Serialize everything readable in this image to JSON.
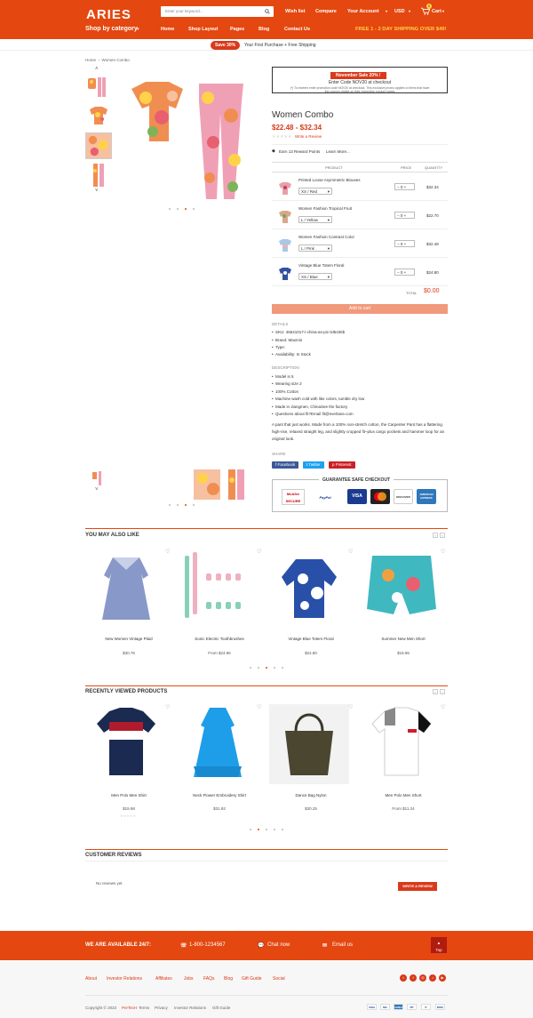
{
  "header": {
    "logo": "ARIES",
    "search_placeholder": "Enter your keyword...",
    "wishlist": "Wish list",
    "compare": "Compare",
    "account": "Your Account",
    "currency": "USD",
    "cart": "Cart",
    "cart_count": "0",
    "category": "Shop by category",
    "nav": [
      "Home",
      "Shop Layout",
      "Pages",
      "Blog",
      "Contact Us"
    ],
    "shipping": "FREE 1 - 2 DAY SHIPPING OVER $49!"
  },
  "promo": {
    "badge": "Save 30%",
    "text": "Your First Purchase + Free Shipping"
  },
  "breadcrumb": {
    "home": "Home",
    "current": "Women Combo"
  },
  "sale_box": {
    "title": "November Sale 20% !",
    "line1": "Enter Code NOV20 at checkout",
    "line2": "(*) To redeem enter promotion code NOV20 at checkout. This exclusive promo applies to items that have this coupon visible on their respective product pages"
  },
  "product": {
    "title": "Women Combo",
    "price": "$22.48   - $32.34",
    "review": "Write a Review",
    "reward": "Earn 13 Reward Points",
    "learn_more": "Learn More..."
  },
  "combo_table": {
    "headers": [
      "PRODUCT",
      "PRICE",
      "QUANTITY"
    ],
    "rows": [
      {
        "name": "Printed Loose Asymmetric Blouses",
        "option": "XS / Red",
        "qty": "0",
        "price": "$32.34"
      },
      {
        "name": "Women Fashion Tropical Fruit",
        "option": "L / Yellow",
        "qty": "0",
        "price": "$22.70"
      },
      {
        "name": "Women Fashion Contrast Color",
        "option": "L / Pink",
        "qty": "0",
        "price": "$32.48"
      },
      {
        "name": "Vintage Blue Totem Floral",
        "option": "XS / Blue",
        "qty": "0",
        "price": "$24.80"
      }
    ],
    "total_label": "TOTAL",
    "total": "$0.00"
  },
  "add_to_cart": "Add to cart",
  "details": {
    "title": "DETAILS",
    "items": [
      "SKU: 45541017-i-china-as-pic-lxl5436b",
      "Brand: Maxmin",
      "Type:",
      "Availability: In Stock"
    ]
  },
  "description": {
    "title": "DESCRIPTION",
    "items": [
      "Model is 5",
      "Wearing size 2",
      "100% Cotton",
      "Machine wash cold with like colors, tumble dry low",
      "Made in Jiangmen, ChinaSee the factory",
      "Questions about fit?Email fit@everlane.com"
    ],
    "para": "A pant that just works. Made from a 100% non-stretch cotton, the Carpenter Pant has a flattering high-rise, relaxed straight leg, and slightly cropped fit–plus cargo pockets and hammer loop for an original look."
  },
  "share": {
    "title": "SHARE",
    "facebook": "Facebook",
    "twitter": "Twitter",
    "pinterest": "Pinterest"
  },
  "guarantee": {
    "title": "GUARANTEE SAFE CHECKOUT",
    "mcafee": "McAfee SECURE",
    "paypal": "PayPal",
    "visa": "VISA",
    "discover": "DISCOVER",
    "amex": "AMERICAN EXPRESS"
  },
  "also_like": {
    "title": "YOU MAY ALSO LIKE",
    "items": [
      {
        "name": "New Women Vintage Plaid",
        "price": "$30.76"
      },
      {
        "name": "Sonic Electric Toothbrushes",
        "price": "From $24.96"
      },
      {
        "name": "Vintage Blue Totem Floral",
        "price": "$24.80"
      },
      {
        "name": "Summer New Men Short",
        "price": "$18.96"
      }
    ]
  },
  "recent": {
    "title": "RECENTLY VIEWED PRODUCTS",
    "items": [
      {
        "name": "Men Polo Men Shirt",
        "price": "$19.98"
      },
      {
        "name": "Neck Flower Embroidery Shirt",
        "price": "$31.92"
      },
      {
        "name": "Dance Bag Nylon",
        "price": "$30.25"
      },
      {
        "name": "Men Polo Men Short",
        "price": "From $11.24"
      }
    ]
  },
  "reviews": {
    "title": "CUSTOMER REVIEWS",
    "empty": "No reviews yet",
    "button": "WRITE A REVIEW"
  },
  "footer": {
    "available": "WE ARE AVAILABLE 24/7:",
    "phone": "1-800-1234567",
    "chat": "Chat now",
    "email": "Email us",
    "top": "Top",
    "links": [
      "About",
      "Investor Relations",
      "Affiliates",
      "Jobs",
      "FAQs",
      "Blog",
      "Gift Guide",
      "Social"
    ],
    "copyright": "Copyright © 2022",
    "brand": "PerTecH",
    "legal": [
      "Terms",
      "Privacy",
      "Investor Relations",
      "Gift Guide"
    ],
    "payments": [
      "VISA",
      "MC",
      "AMEX",
      "PP",
      "P",
      "DISC"
    ]
  },
  "colors": {
    "accent": "#e4470f",
    "price": "#d93a1a",
    "ship": "#ffd24a"
  }
}
